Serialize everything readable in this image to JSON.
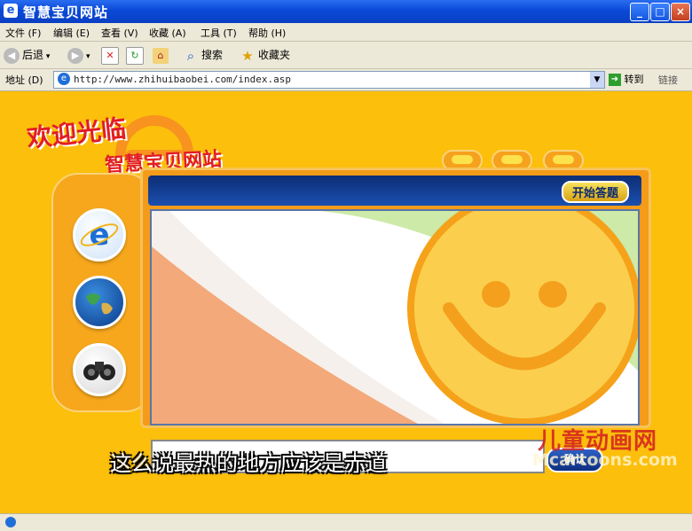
{
  "window": {
    "title": "智慧宝贝网站",
    "minimize": "_",
    "maximize": "□",
    "close": "×"
  },
  "menu": [
    "文件 (F)",
    "编辑 (E)",
    "查看 (V)",
    "收藏 (A)",
    "工具 (T)",
    "帮助 (H)"
  ],
  "toolbar": {
    "back": "后退",
    "search": "搜索",
    "favorites": "收藏夹"
  },
  "address": {
    "label": "地址 (D)",
    "url": "http://www.zhihuibaobei.com/index.asp",
    "go": "转到",
    "links": "链接"
  },
  "page": {
    "welcome_line1": "欢迎光临",
    "welcome_line2": "智慧宝贝网站",
    "start_button": "开始答题",
    "confirm_button": "确认",
    "subtitle": "这么说最热的地方应该是赤道",
    "watermark_cn": "儿童动画网",
    "watermark_en": "Mcartoons.com"
  },
  "icons": {
    "browser": "internet-explorer-icon",
    "globe": "globe-icon",
    "binoculars": "binoculars-icon",
    "smiley": "sun-smiley-face"
  },
  "colors": {
    "page_background": "#fcbf0c",
    "frame": "#f49b1a",
    "frame_header": "#0d2e75",
    "sun": "#fbcf4d"
  }
}
